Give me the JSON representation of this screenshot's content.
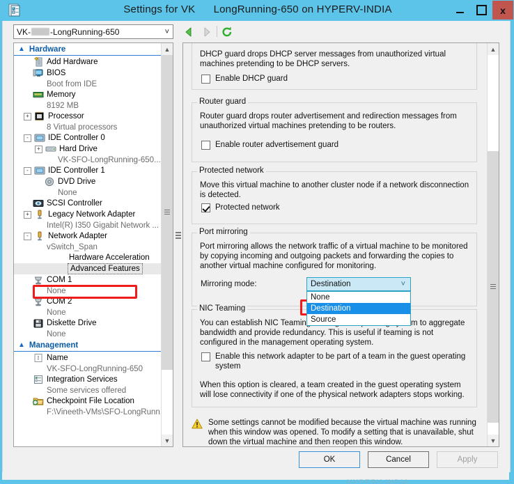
{
  "window": {
    "title": "Settings for VK      LongRunning-650 on HYPERV-INDIA",
    "icon": "settings-document-icon",
    "minimize_label": "",
    "maximize_label": "",
    "close_label": "x",
    "close_color": "#c0564e",
    "titlebar_color": "#5bc4e8"
  },
  "toolbar": {
    "vm_combo_prefix": "VK-",
    "vm_combo_suffix": "-LongRunning-650",
    "vm_combo_redacted": true,
    "back_icon": "nav-back-icon",
    "forward_icon": "nav-forward-icon",
    "refresh_icon": "refresh-icon"
  },
  "tree": {
    "groups": [
      {
        "label": "Hardware",
        "items": [
          {
            "label": "Add Hardware",
            "icon": "add-hardware-icon",
            "indent": 0,
            "expander": "",
            "sub": ""
          },
          {
            "label": "BIOS",
            "icon": "bios-icon",
            "indent": 0,
            "expander": "",
            "sub": "Boot from IDE"
          },
          {
            "label": "Memory",
            "icon": "memory-icon",
            "indent": 0,
            "expander": "",
            "sub": "8192 MB"
          },
          {
            "label": "Processor",
            "icon": "processor-icon",
            "indent": 0,
            "expander": "+",
            "sub": "8 Virtual processors"
          },
          {
            "label": "IDE Controller 0",
            "icon": "ide-controller-icon",
            "indent": 0,
            "expander": "-",
            "sub": ""
          },
          {
            "label": "Hard Drive",
            "icon": "hard-drive-icon",
            "indent": 1,
            "expander": "+",
            "sub": "VK-SFO-LongRunning-650...."
          },
          {
            "label": "IDE Controller 1",
            "icon": "ide-controller-icon",
            "indent": 0,
            "expander": "-",
            "sub": ""
          },
          {
            "label": "DVD Drive",
            "icon": "dvd-drive-icon",
            "indent": 1,
            "expander": "",
            "sub": "None"
          },
          {
            "label": "SCSI Controller",
            "icon": "scsi-controller-icon",
            "indent": 0,
            "expander": "",
            "sub": ""
          },
          {
            "label": "Legacy Network Adapter",
            "icon": "network-adapter-icon",
            "indent": 0,
            "expander": "+",
            "sub": "Intel(R) I350 Gigabit Network ..."
          },
          {
            "label": "Network Adapter",
            "icon": "network-adapter-icon",
            "indent": 0,
            "expander": "-",
            "sub": "vSwitch_Span"
          },
          {
            "label": "Hardware Acceleration",
            "icon": "",
            "indent": 2,
            "expander": "",
            "sub": ""
          },
          {
            "label": "Advanced Features",
            "icon": "",
            "indent": 2,
            "expander": "",
            "sub": "",
            "selected": true,
            "annotated": true
          },
          {
            "label": "COM 1",
            "icon": "com-port-icon",
            "indent": 0,
            "expander": "",
            "sub": "None"
          },
          {
            "label": "COM 2",
            "icon": "com-port-icon",
            "indent": 0,
            "expander": "",
            "sub": "None"
          },
          {
            "label": "Diskette Drive",
            "icon": "diskette-drive-icon",
            "indent": 0,
            "expander": "",
            "sub": "None"
          }
        ]
      },
      {
        "label": "Management",
        "items": [
          {
            "label": "Name",
            "icon": "name-icon",
            "indent": 0,
            "expander": "",
            "sub": "VK-SFO-LongRunning-650"
          },
          {
            "label": "Integration Services",
            "icon": "integration-services-icon",
            "indent": 0,
            "expander": "",
            "sub": "Some services offered"
          },
          {
            "label": "Checkpoint File Location",
            "icon": "checkpoint-folder-icon",
            "indent": 0,
            "expander": "",
            "sub": "F:\\Vineeth-VMs\\SFO-LongRunn..."
          }
        ]
      }
    ]
  },
  "panel": {
    "dhcp_guard": {
      "description": "DHCP guard drops DHCP server messages from unauthorized virtual machines pretending to be DHCP servers.",
      "checkbox_label": "Enable DHCP guard",
      "checked": false
    },
    "router_guard": {
      "legend": "Router guard",
      "description": "Router guard drops router advertisement and redirection messages from unauthorized virtual machines pretending to be routers.",
      "checkbox_label": "Enable router advertisement guard",
      "checked": false
    },
    "protected_network": {
      "legend": "Protected network",
      "description": "Move this virtual machine to another cluster node if a network disconnection is detected.",
      "checkbox_label": "Protected network",
      "checked": true
    },
    "port_mirroring": {
      "legend": "Port mirroring",
      "description": "Port mirroring allows the network traffic of a virtual machine to be monitored by copying incoming and outgoing packets and forwarding the copies to another virtual machine configured for monitoring.",
      "mode_label": "Mirroring mode:",
      "mode_value": "Destination",
      "mode_options": [
        "None",
        "Destination",
        "Source"
      ],
      "mode_selected_index": 1,
      "dropdown_open": true,
      "highlight_color": "#1a8fe8",
      "annotated": true
    },
    "nic_teaming": {
      "legend": "NIC Teaming",
      "description": "You can establish NIC Teaming in the guest operating system to aggregate bandwidth and provide redundancy. This is useful if teaming is not configured in the management operating system.",
      "checkbox_label": "Enable this network adapter to be part of a team in the guest operating system",
      "checked": false,
      "note": "When this option is cleared, a team created in the guest operating system will lose connectivity if one of the physical network adapters stops working."
    },
    "warning": {
      "icon": "warning-triangle-icon",
      "text": "Some settings cannot be modified because the virtual machine was running when this window was opened. To modify a setting that is unavailable, shut down the virtual machine and then reopen this window."
    }
  },
  "buttons": {
    "ok": "OK",
    "cancel": "Cancel",
    "apply": "Apply",
    "apply_enabled": false
  },
  "annotations": {
    "box_color": "#f21b1b"
  },
  "watermark": "HYPERV-INDIA"
}
